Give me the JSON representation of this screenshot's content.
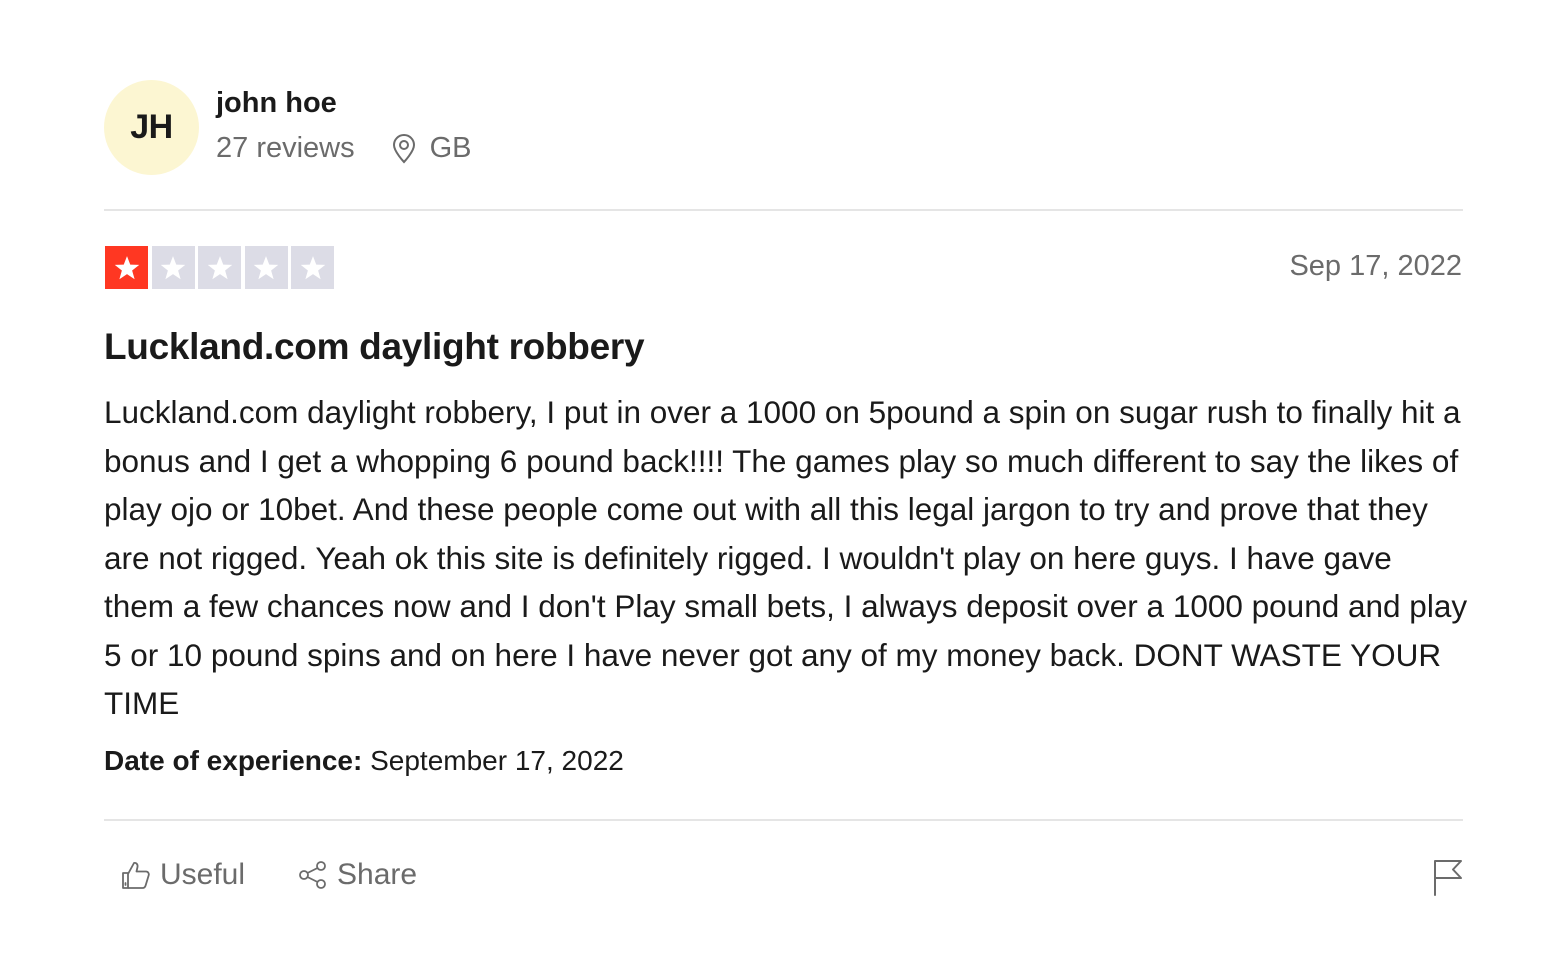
{
  "consumer": {
    "initials": "JH",
    "name": "john hoe",
    "reviews_count": "27 reviews",
    "country": "GB",
    "avatar_color": "#fcf6d2"
  },
  "review": {
    "rating": 1,
    "max_rating": 5,
    "star_filled_color": "#ff3722",
    "star_empty_color": "#dcdce6",
    "date": "Sep 17, 2022",
    "title": "Luckland.com daylight robbery",
    "body": "Luckland.com daylight robbery, I put in over a 1000 on 5pound a spin on sugar rush to finally hit a bonus and I get a whopping 6 pound back!!!! The games play so much different to say the likes of play ojo or 10bet. And these people come out with all this legal jargon to try and prove that they are not rigged. Yeah ok this site is definitely rigged. I wouldn't play on here guys. I have gave them a few chances now and I don't Play small bets, I always deposit over a 1000 pound and play 5 or 10 pound spins and on here I have never got any of my money back. DONT WASTE YOUR TIME",
    "experience_label": "Date of experience:",
    "experience_date": "September 17, 2022"
  },
  "actions": {
    "useful_label": "Useful",
    "share_label": "Share",
    "useful_icon": "thumbs-up-icon",
    "share_icon": "share-icon",
    "flag_icon": "flag-icon"
  }
}
